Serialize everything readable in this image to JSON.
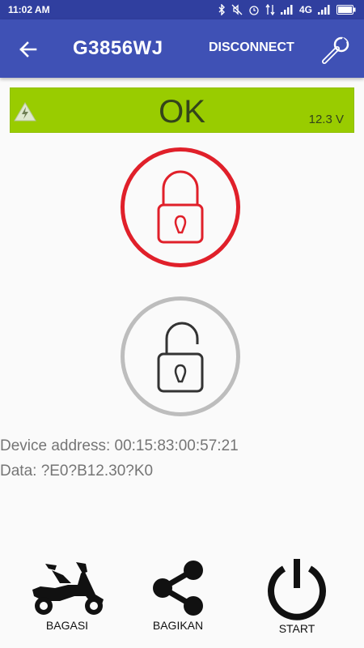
{
  "status_bar": {
    "time": "11:02 AM",
    "network": "4G"
  },
  "app_bar": {
    "title": "G3856WJ",
    "disconnect_label": "DISCONNECT"
  },
  "status_panel": {
    "state": "OK",
    "voltage": "12.3 V",
    "background_color": "#99cc00"
  },
  "lock_buttons": {
    "lock_color": "#e0202a",
    "unlock_color": "#bdbdbd"
  },
  "info": {
    "address_line": "Device address: 00:15:83:00:57:21",
    "data_line": "Data: ?E0?B12.30?K0"
  },
  "actions": [
    {
      "label": "BAGASI",
      "icon": "scooter-icon"
    },
    {
      "label": "BAGIKAN",
      "icon": "share-icon"
    },
    {
      "label": "START",
      "icon": "power-icon"
    }
  ]
}
